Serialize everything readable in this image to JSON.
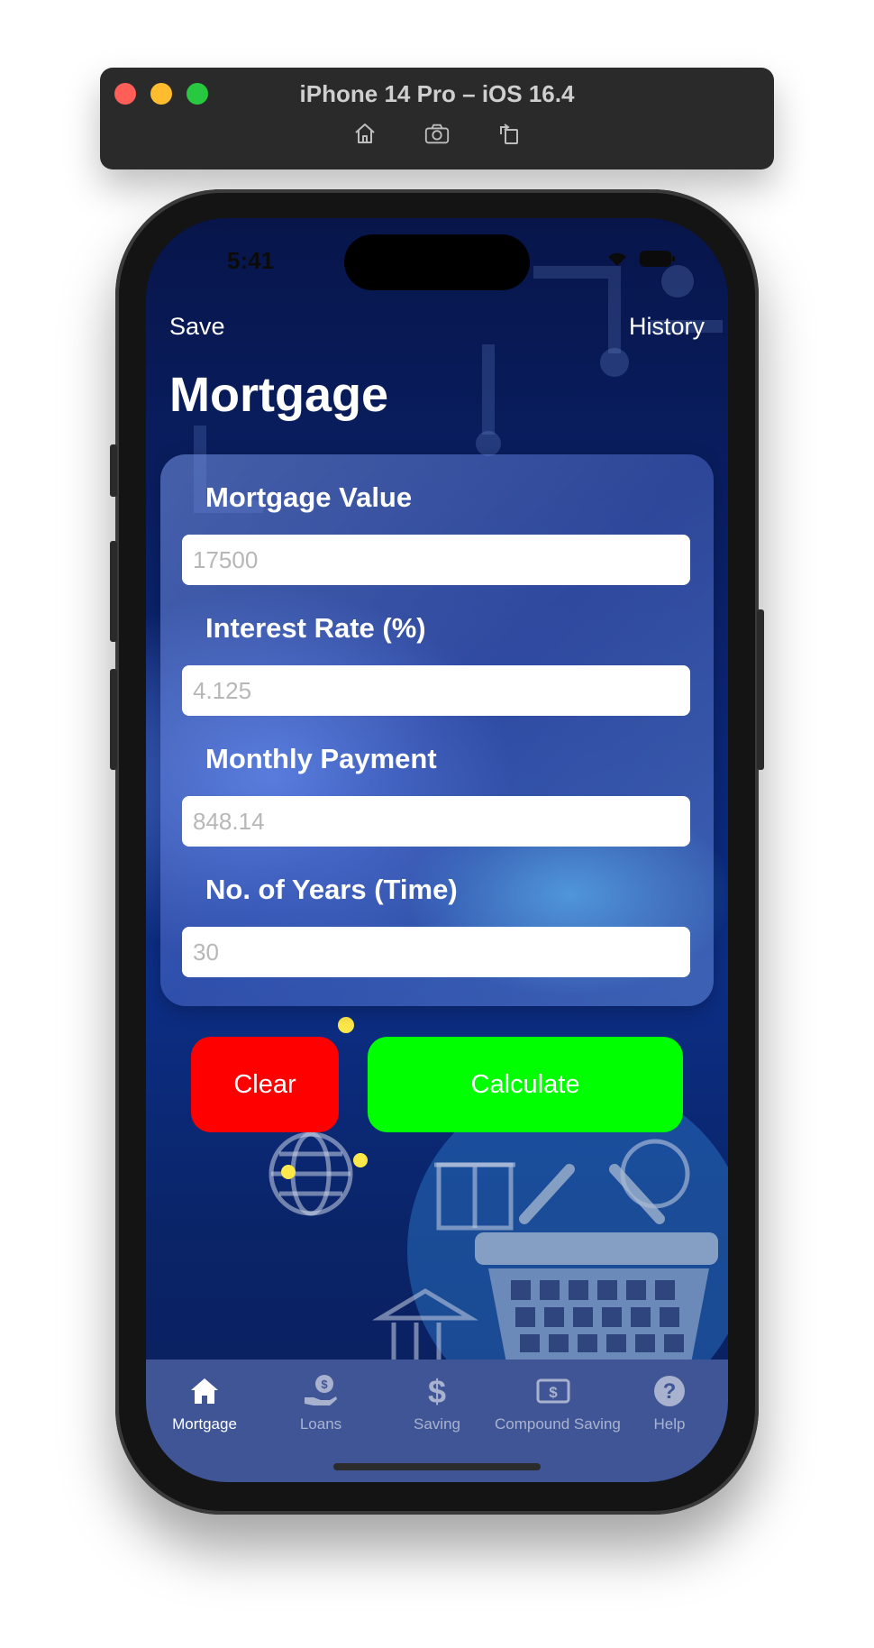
{
  "simulator": {
    "title": "iPhone 14 Pro – iOS 16.4",
    "tools": [
      "home-icon",
      "screenshot-icon",
      "rotate-icon"
    ]
  },
  "status": {
    "time": "5:41"
  },
  "nav": {
    "save_label": "Save",
    "history_label": "History"
  },
  "page": {
    "title": "Mortgage"
  },
  "form": {
    "fields": [
      {
        "label": "Mortgage Value",
        "placeholder": "17500"
      },
      {
        "label": "Interest Rate (%)",
        "placeholder": "4.125"
      },
      {
        "label": "Monthly Payment",
        "placeholder": "848.14"
      },
      {
        "label": "No. of Years (Time)",
        "placeholder": "30"
      }
    ]
  },
  "buttons": {
    "clear_label": "Clear",
    "calculate_label": "Calculate"
  },
  "colors": {
    "clear": "#ff0000",
    "calculate": "#00ff00",
    "tabbar": "#3f5595"
  },
  "tabbar": {
    "tabs": [
      {
        "label": "Mortgage",
        "icon": "house-icon",
        "active": true
      },
      {
        "label": "Loans",
        "icon": "hand-dollar-icon",
        "active": false
      },
      {
        "label": "Saving",
        "icon": "dollar-icon",
        "active": false
      },
      {
        "label": "Compound Saving",
        "icon": "banknote-icon",
        "active": false
      },
      {
        "label": "Help",
        "icon": "question-icon",
        "active": false
      }
    ]
  }
}
